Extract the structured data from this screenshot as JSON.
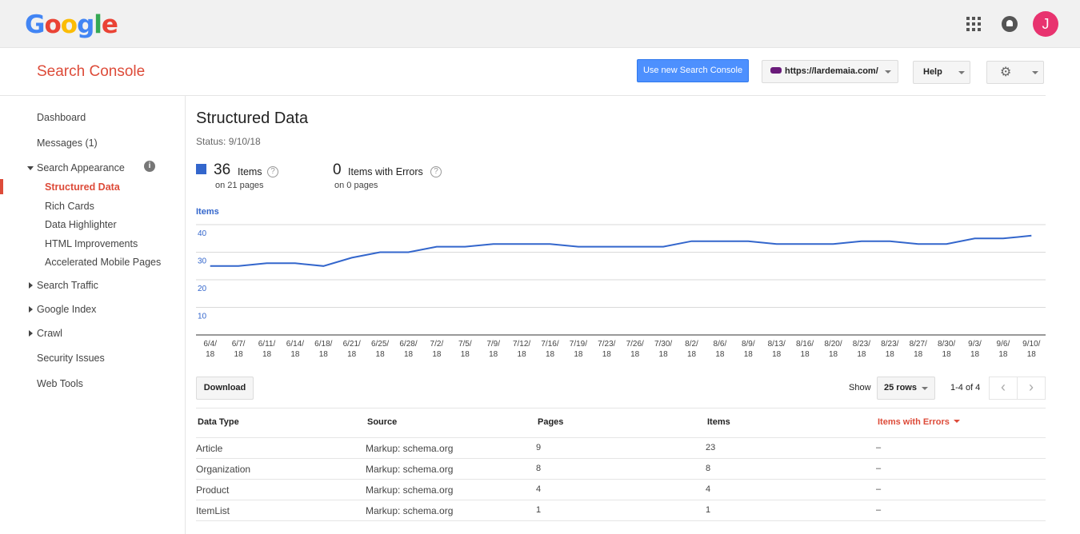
{
  "topbar": {
    "logo_letters": [
      {
        "ch": "G",
        "color": "#4285f4"
      },
      {
        "ch": "o",
        "color": "#ea4335"
      },
      {
        "ch": "o",
        "color": "#fbbc05"
      },
      {
        "ch": "g",
        "color": "#4285f4"
      },
      {
        "ch": "l",
        "color": "#34a853"
      },
      {
        "ch": "e",
        "color": "#ea4335"
      }
    ],
    "apps_icon": "apps-grid-icon",
    "notifications_icon": "bell-icon",
    "avatar_letter": "J",
    "avatar_color": "#e8336f"
  },
  "header": {
    "app_title": "Search Console",
    "new_console_label": "Use new Search Console",
    "site": "https://lardemaia.com/",
    "help_label": "Help",
    "settings_icon": "gear-icon"
  },
  "sidebar": {
    "dashboard": "Dashboard",
    "messages": "Messages (1)",
    "search_appearance": "Search Appearance",
    "search_appearance_items": [
      "Structured Data",
      "Rich Cards",
      "Data Highlighter",
      "HTML Improvements",
      "Accelerated Mobile Pages"
    ],
    "active_item": "Structured Data",
    "search_traffic": "Search Traffic",
    "google_index": "Google Index",
    "crawl": "Crawl",
    "security_issues": "Security Issues",
    "web_tools": "Web Tools"
  },
  "main": {
    "title": "Structured Data",
    "status": "Status: 9/10/18",
    "items_count": "36",
    "items_label": "Items",
    "items_sub": "on 21 pages",
    "errors_count": "0",
    "errors_label": "Items with Errors",
    "errors_sub": "on 0 pages",
    "chart_label": "Items"
  },
  "chart_data": {
    "type": "line",
    "series_color": "#3366cc",
    "x": [
      "6/4/18",
      "6/7/18",
      "6/11/18",
      "6/14/18",
      "6/18/18",
      "6/21/18",
      "6/25/18",
      "6/28/18",
      "7/2/18",
      "7/5/18",
      "7/9/18",
      "7/12/18",
      "7/16/18",
      "7/19/18",
      "7/23/18",
      "7/26/18",
      "7/30/18",
      "8/2/18",
      "8/6/18",
      "8/9/18",
      "8/13/18",
      "8/16/18",
      "8/20/18",
      "8/23/18",
      "8/23/18",
      "8/27/18",
      "8/30/18",
      "9/3/18",
      "9/6/18",
      "9/10/18"
    ],
    "x_tick_labels": [
      [
        "6/4/",
        "18"
      ],
      [
        "6/7/",
        "18"
      ],
      [
        "6/11/",
        "18"
      ],
      [
        "6/14/",
        "18"
      ],
      [
        "6/18/",
        "18"
      ],
      [
        "6/21/",
        "18"
      ],
      [
        "6/25/",
        "18"
      ],
      [
        "6/28/",
        "18"
      ],
      [
        "7/2/",
        "18"
      ],
      [
        "7/5/",
        "18"
      ],
      [
        "7/9/",
        "18"
      ],
      [
        "7/12/",
        "18"
      ],
      [
        "7/16/",
        "18"
      ],
      [
        "7/19/",
        "18"
      ],
      [
        "7/23/",
        "18"
      ],
      [
        "7/26/",
        "18"
      ],
      [
        "7/30/",
        "18"
      ],
      [
        "8/2/",
        "18"
      ],
      [
        "8/6/",
        "18"
      ],
      [
        "8/9/",
        "18"
      ],
      [
        "8/13/",
        "18"
      ],
      [
        "8/16/",
        "18"
      ],
      [
        "8/20/",
        "18"
      ],
      [
        "8/23/",
        "18"
      ],
      [
        "8/23/",
        "18"
      ],
      [
        "8/27/",
        "18"
      ],
      [
        "8/30/",
        "18"
      ],
      [
        "9/3/",
        "18"
      ],
      [
        "9/6/",
        "18"
      ],
      [
        "9/10/",
        "18"
      ]
    ],
    "values": [
      25,
      25,
      26,
      26,
      25,
      28,
      30,
      30,
      32,
      32,
      33,
      33,
      33,
      32,
      32,
      32,
      32,
      34,
      34,
      34,
      33,
      33,
      33,
      34,
      34,
      33,
      33,
      35,
      35,
      36
    ],
    "yticks": [
      10,
      20,
      30,
      40
    ],
    "ylim": [
      0,
      40
    ],
    "grid": true
  },
  "toolbar": {
    "download_label": "Download",
    "show_label": "Show",
    "rows_label": "25 rows",
    "range_label": "1-4 of 4",
    "prev_icon": "chevron-left-icon",
    "next_icon": "chevron-right-icon"
  },
  "table": {
    "headers": [
      "Data Type",
      "Source",
      "Pages",
      "Items",
      "Items with Errors"
    ],
    "rows": [
      [
        "Article",
        "Markup: schema.org",
        "9",
        "23",
        "–"
      ],
      [
        "Organization",
        "Markup: schema.org",
        "8",
        "8",
        "–"
      ],
      [
        "Product",
        "Markup: schema.org",
        "4",
        "4",
        "–"
      ],
      [
        "ItemList",
        "Markup: schema.org",
        "1",
        "1",
        "–"
      ]
    ]
  }
}
